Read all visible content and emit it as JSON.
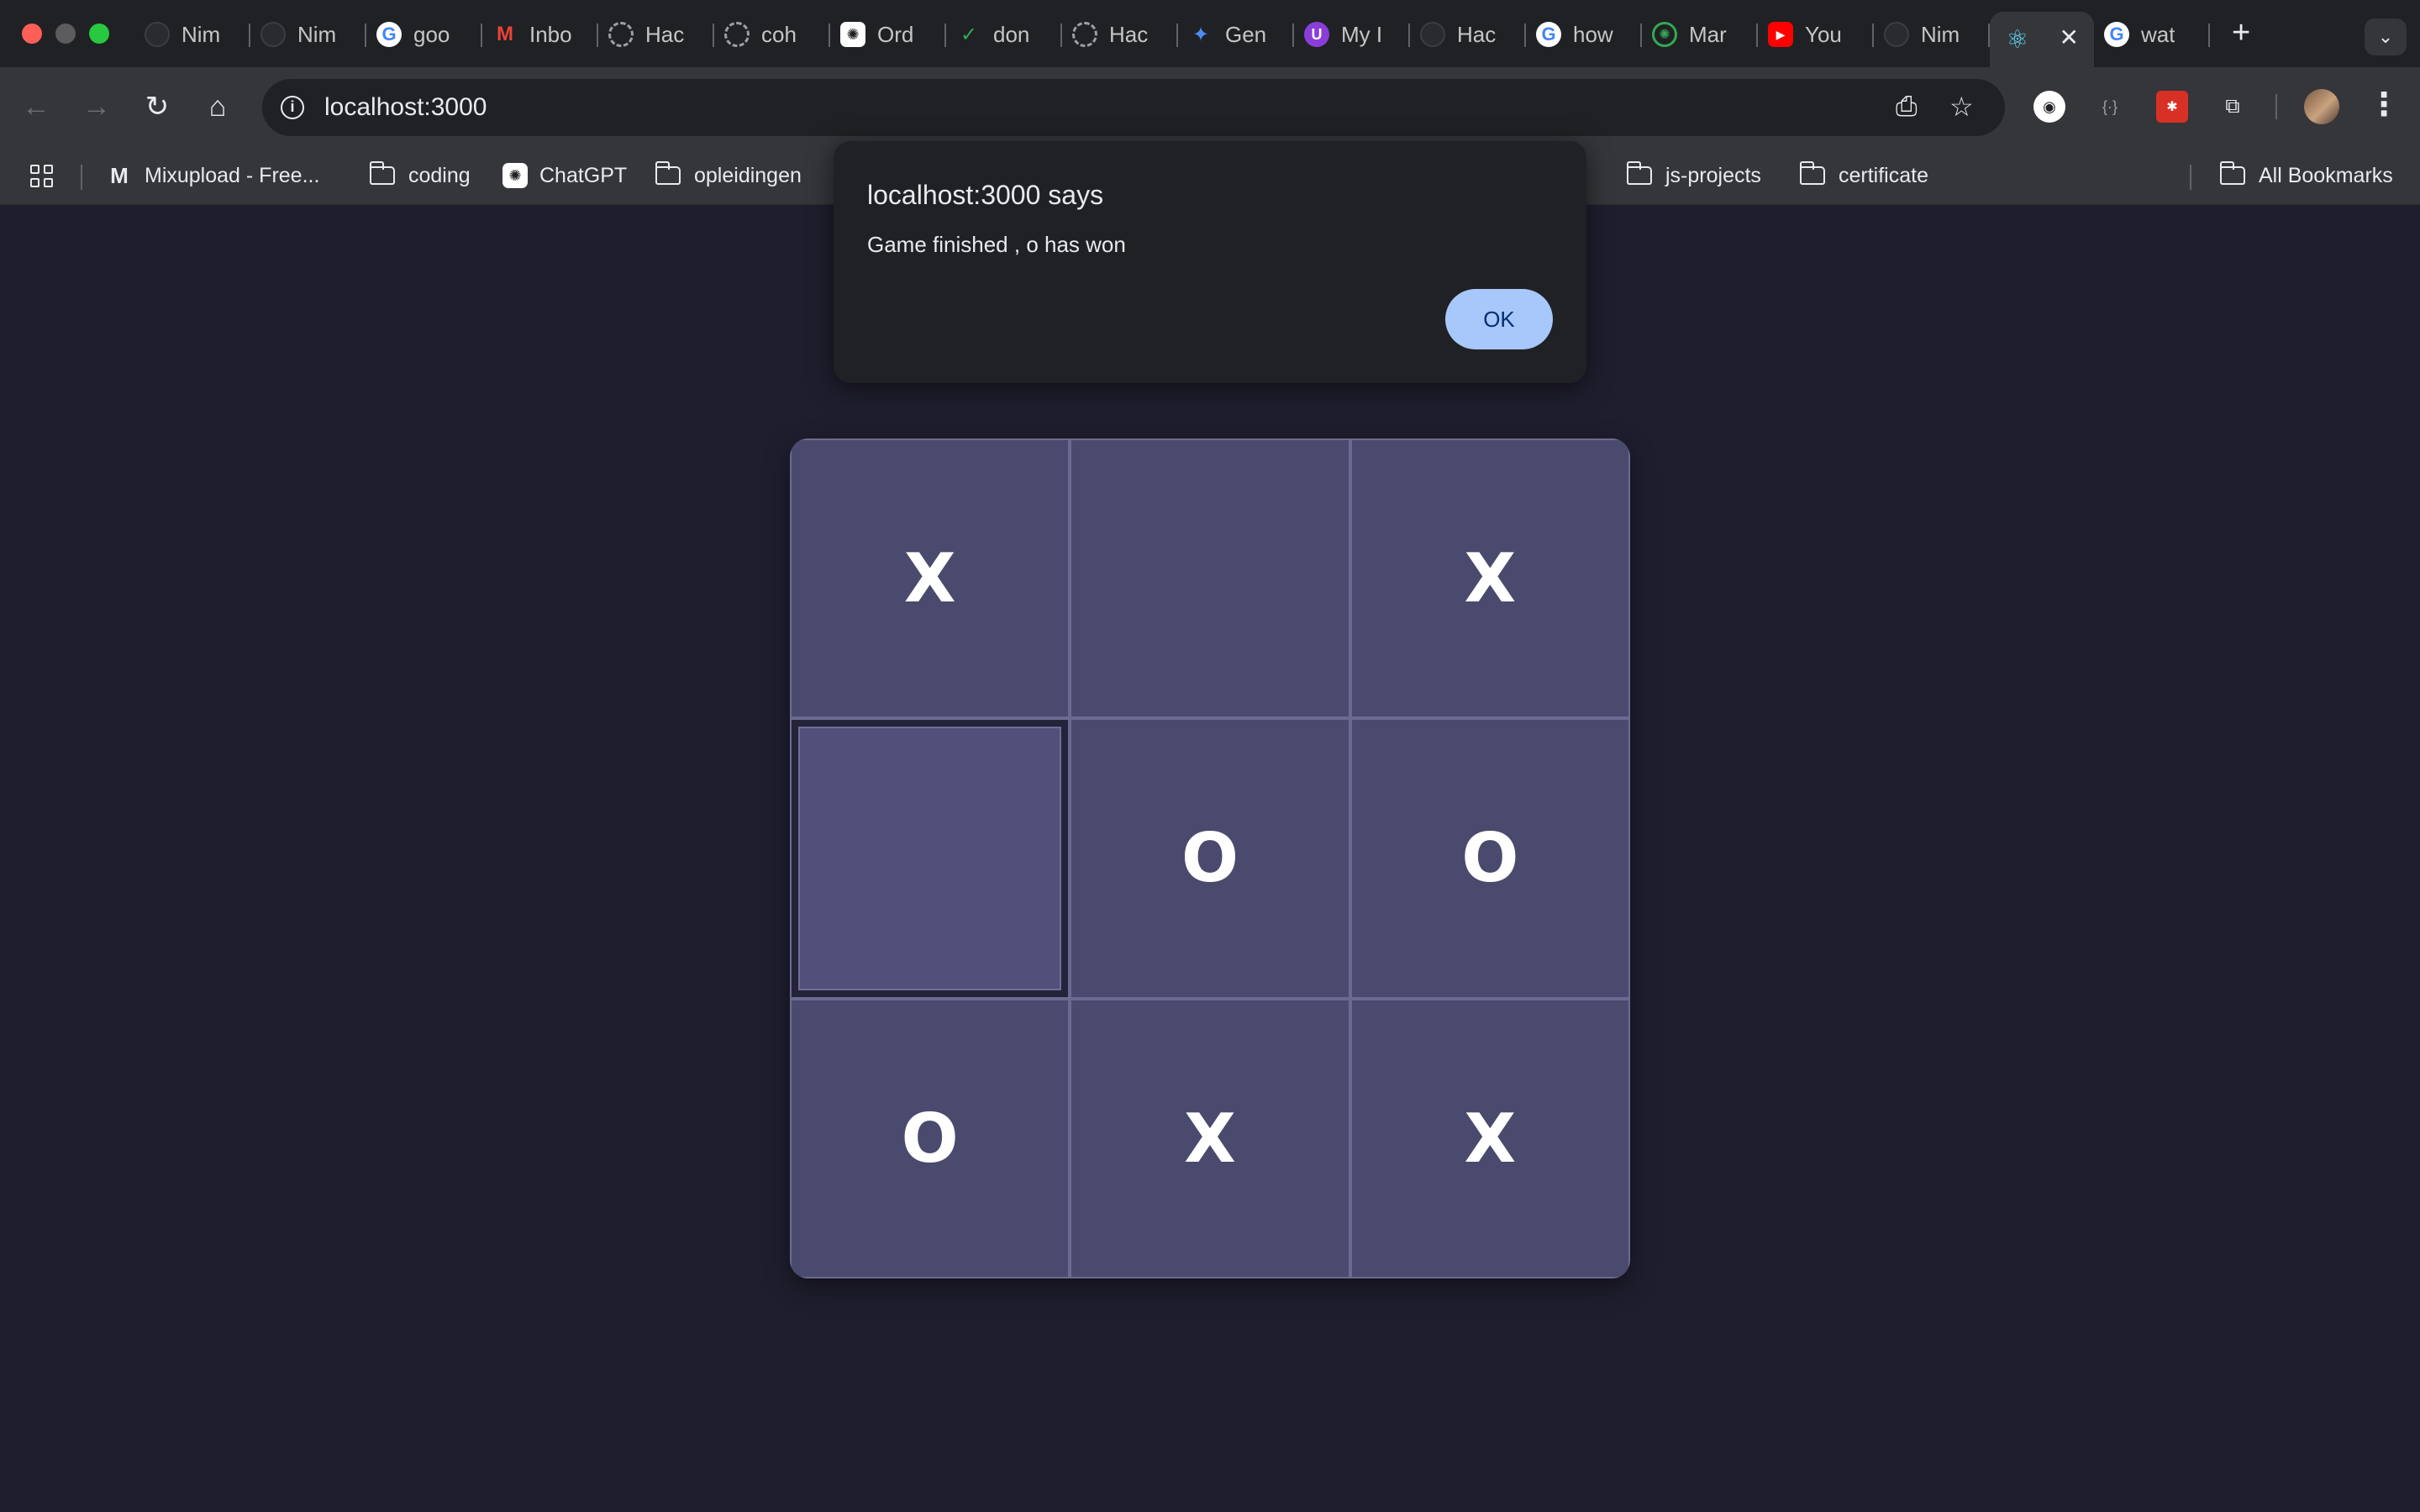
{
  "browser": {
    "tabs": [
      {
        "title": "Nim",
        "icon": "github-icon"
      },
      {
        "title": "Nim",
        "icon": "github-icon"
      },
      {
        "title": "goo",
        "icon": "google-icon"
      },
      {
        "title": "Inbo",
        "icon": "gmail-icon"
      },
      {
        "title": "Hac",
        "icon": "loading-ring-icon"
      },
      {
        "title": "coh",
        "icon": "loading-ring-icon"
      },
      {
        "title": "Ord",
        "icon": "chatgpt-icon"
      },
      {
        "title": "don",
        "icon": "check-icon"
      },
      {
        "title": "Hac",
        "icon": "loading-ring-icon"
      },
      {
        "title": "Gen",
        "icon": "gemini-icon"
      },
      {
        "title": "My I",
        "icon": "udemy-icon"
      },
      {
        "title": "Hac",
        "icon": "github-icon"
      },
      {
        "title": "how",
        "icon": "google-icon"
      },
      {
        "title": "Mar",
        "icon": "chatgpt-green-icon"
      },
      {
        "title": "You",
        "icon": "youtube-icon"
      },
      {
        "title": "Nim",
        "icon": "github-icon"
      }
    ],
    "active_tab": {
      "icon": "react-icon",
      "close": "✕"
    },
    "after_tab": {
      "title": "wat",
      "icon": "google-icon"
    },
    "new_tab": "+",
    "tab_menu": "⌄",
    "url": "localhost:3000",
    "bookmarks": {
      "mixupload": "Mixupload - Free...",
      "coding": "coding",
      "chatgpt": "ChatGPT",
      "opleidingen": "opleidingen",
      "js_projects": "js-projects",
      "certificate": "certificate",
      "all": "All Bookmarks"
    }
  },
  "dialog": {
    "title": "localhost:3000 says",
    "message": "Game finished , o has won",
    "ok": "OK"
  },
  "board": {
    "cells": [
      "X",
      "",
      "X",
      "",
      "O",
      "O",
      "O",
      "X",
      "X"
    ],
    "hovered_cell": 3
  },
  "colors": {
    "page_bg": "#1f1e2e",
    "cell_bg": "#4a4a6e",
    "ok_button": "#a8c7fa"
  }
}
